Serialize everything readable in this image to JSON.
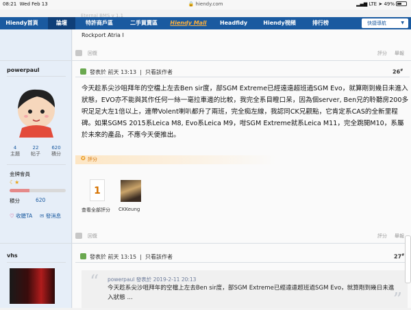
{
  "statusbar": {
    "time": "08:21",
    "date": "Wed Feb 13",
    "url": "hiendy.com",
    "network": "LTE",
    "battery": "49%"
  },
  "nav": {
    "items": [
      "Hiendy首頁",
      "論壇",
      "特許商戶區",
      "二手買賣區",
      "Hiendy Mall",
      "Headfidy",
      "Hiendy視頻",
      "排行榜"
    ],
    "dropdown": "快捷導航"
  },
  "prev_post": {
    "text": "Rockport Atria I",
    "reply": "回復",
    "rate": "評分",
    "report": "舉報"
  },
  "post1": {
    "author": "powerpaul",
    "meta": "發表於  前天 13:13",
    "only_author": "只看該作者",
    "floor": "26",
    "content": "今天趁系尖沙咀拜年的空檔上左去Ben sir度，部SGM Extreme已經遠遠超班過SGM Evo，就算剛到幾日未進入狀態，EVO亦不能與其作任何一絲一毫拉車邊的比較，我完全系目瞪口呆，因為個server, Ben兄的聆聽房200多呎足足大左1倍以上，連帶Volent喇叭都升了兩班，完全痴左線，我認同CK兄觀點，它肯定系CAS的全新里程碑。如果SGMS 2015系Leica M8, Evo系Leica M9，咁SGM Extreme就系Leica M11，完全跳開M10，系屬於未來的產品，不應今天便推出。",
    "rating_label": "評分",
    "rate_count": "1",
    "rate_all": "查看全部評分",
    "rater": "CKKeung",
    "reply": "回復",
    "rate": "評分",
    "report": "舉報",
    "stats": [
      {
        "num": "4",
        "label": "主題"
      },
      {
        "num": "22",
        "label": "帖子"
      },
      {
        "num": "620",
        "label": "積分"
      }
    ],
    "rank": "金牌會員",
    "rank_progress": 0.35,
    "points_label": "積分",
    "points": "620",
    "fav": "收聽TA",
    "pm": "發消息"
  },
  "post2": {
    "author": "vhs",
    "meta": "發表於  前天 13:15",
    "only_author": "只看該作者",
    "floor": "27",
    "quote_head": "powerpaul 發表於 2019-2-11 20:13",
    "quote_text": "今天趁系尖沙咀拜年的空檔上左去Ben sir度，部SGM Extreme已經遠遠超班過SGM Evo，就算剛到幾日未進入狀態 ..."
  }
}
